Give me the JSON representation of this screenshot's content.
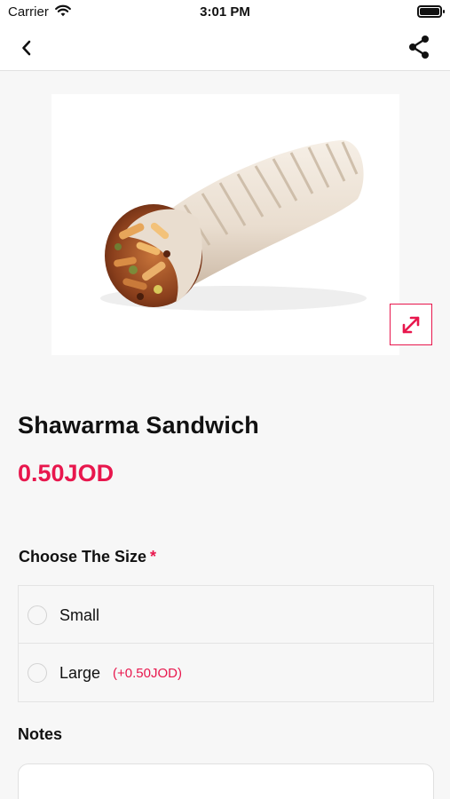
{
  "status_bar": {
    "carrier": "Carrier",
    "time": "3:01 PM",
    "wifi_icon": "wifi-icon",
    "battery_icon": "battery-icon"
  },
  "nav": {
    "back_icon": "chevron-left-icon",
    "share_icon": "share-icon"
  },
  "product": {
    "image_icon": "shawarma-sandwich-image",
    "expand_icon": "expand-icon",
    "name": "Shawarma Sandwich",
    "price": "0.50JOD"
  },
  "size_section": {
    "title": "Choose The Size",
    "required_mark": "*",
    "options": [
      {
        "label": "Small",
        "extra": ""
      },
      {
        "label": "Large",
        "extra": "(+0.50JOD)"
      }
    ]
  },
  "notes": {
    "title": "Notes",
    "value": "",
    "placeholder": ""
  },
  "colors": {
    "accent": "#e8174d",
    "background": "#f7f7f7",
    "text": "#111111"
  }
}
